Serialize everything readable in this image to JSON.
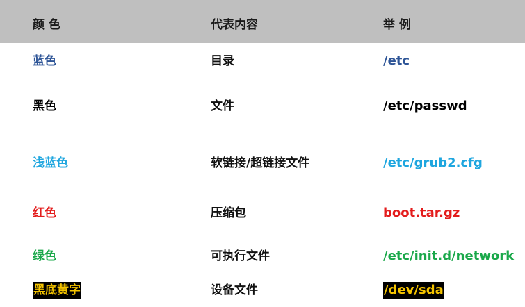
{
  "header": {
    "col1": "颜 色",
    "col2": "代表内容",
    "col3": "举 例"
  },
  "rows": [
    {
      "color_name": "蓝色",
      "meaning": "目录",
      "example": "/etc",
      "color": "#2e5597",
      "bg": ""
    },
    {
      "color_name": "黑色",
      "meaning": "文件",
      "example": "/etc/passwd",
      "color": "#000000",
      "bg": ""
    },
    {
      "color_name": "浅蓝色",
      "meaning": "软链接/超链接文件",
      "example": "/etc/grub2.cfg",
      "color": "#1ea6df",
      "bg": ""
    },
    {
      "color_name": "红色",
      "meaning": "压缩包",
      "example": "boot.tar.gz",
      "color": "#e31c1c",
      "bg": ""
    },
    {
      "color_name": "绿色",
      "meaning": "可执行文件",
      "example": "/etc/init.d/network",
      "color": "#1aa84a",
      "bg": ""
    },
    {
      "color_name": "黑底黄字",
      "meaning": "设备文件",
      "example": "/dev/sda",
      "color": "#f5c400",
      "bg": "#000000"
    }
  ]
}
